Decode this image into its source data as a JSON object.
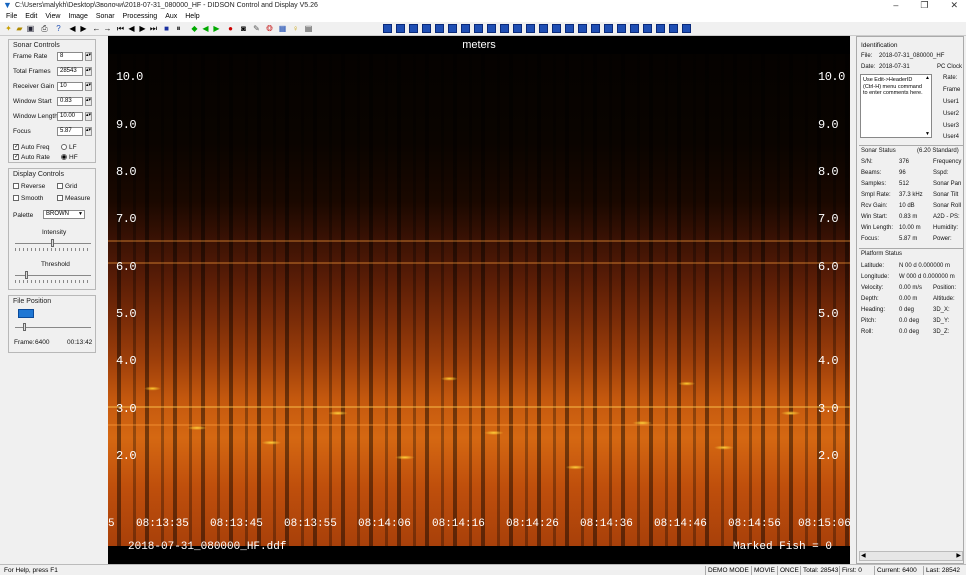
{
  "window": {
    "title": "C:\\Users\\malykh\\Desktop\\Зволочи\\2018-07-31_080000_HF - DIDSON Control and Display  V5.26",
    "minimize": "–",
    "maximize": "❐",
    "close": "✕"
  },
  "menu": [
    "File",
    "Edit",
    "View",
    "Image",
    "Sonar",
    "Processing",
    "Aux",
    "Help"
  ],
  "sonar_controls": {
    "title": "Sonar Controls",
    "frame_rate_label": "Frame Rate",
    "frame_rate": "8",
    "total_frames_label": "Total Frames",
    "total_frames": "28543",
    "receiver_gain_label": "Receiver Gain",
    "receiver_gain": "10",
    "window_start_label": "Window Start",
    "window_start": "0.83",
    "window_length_label": "Window Length",
    "window_length": "10.00",
    "focus_label": "Focus",
    "focus": "5.87",
    "auto_freq": "Auto Freq",
    "auto_rate": "Auto Rate",
    "lf": "LF",
    "hf": "HF"
  },
  "display_controls": {
    "title": "Display Controls",
    "reverse": "Reverse",
    "grid": "Grid",
    "smooth": "Smooth",
    "measure": "Measure",
    "palette_label": "Palette",
    "palette": "BROWN",
    "intensity_label": "Intensity",
    "threshold_label": "Threshold"
  },
  "file_position": {
    "title": "File Position",
    "frame_label": "Frame:",
    "frame": "6400",
    "time": "00:13:42"
  },
  "viewer": {
    "units": "meters",
    "y_labels": [
      "10.0",
      "9.0",
      "8.0",
      "7.0",
      "6.0",
      "5.0",
      "4.0",
      "3.0",
      "2.0"
    ],
    "time_labels": [
      "08:13:35",
      "08:13:45",
      "08:13:55",
      "08:14:06",
      "08:14:16",
      "08:14:26",
      "08:14:36",
      "08:14:46",
      "08:14:56",
      "08:15:06"
    ],
    "left_partial": "5",
    "filename": "2018-07-31_080000_HF.ddf",
    "marked_fish": "Marked Fish = 0"
  },
  "identification": {
    "title": "Identification",
    "file_label": "File:",
    "file": "2018-07-31_080000_HF",
    "date_label": "Date:",
    "date": "2018-07-31",
    "pc_clock": "PC Clock",
    "comment_lines": [
      "Use Edit->HeaderID",
      "(Ctrl-H) menu command",
      "to enter comments here."
    ],
    "side": [
      "Rate:",
      "Frame",
      "User1",
      "User2",
      "User3",
      "User4"
    ]
  },
  "sonar_status": {
    "title": "Sonar Status",
    "standard": "(6.20 Standard)",
    "rows": [
      [
        "S/N:",
        "376",
        "Frequency"
      ],
      [
        "Beams:",
        "96",
        "Sspd:"
      ],
      [
        "Samples:",
        "512",
        "Sonar Pan"
      ],
      [
        "Smpl Rate:",
        "37.3 kHz",
        "Sonar Tilt"
      ],
      [
        "Rcv Gain:",
        "10 dB",
        "Sonar Roll"
      ],
      [
        "Win Start:",
        "0.83 m",
        "A2D - PS:"
      ],
      [
        "Win Length:",
        "10.00 m",
        "Humidity:"
      ],
      [
        "Focus:",
        "5.87 m",
        "Power:"
      ]
    ]
  },
  "platform_status": {
    "title": "Platform Status",
    "rows": [
      [
        "Latitude:",
        "N  00 d  0.000000 m"
      ],
      [
        "Longitude:",
        "W 000 d  0.000000 m"
      ],
      [
        "Velocity:",
        "0.00 m/s",
        "Position:"
      ],
      [
        "Depth:",
        "0.00 m",
        "Altitude:"
      ],
      [
        "Heading:",
        "0 deg",
        "3D_X:"
      ],
      [
        "Pitch:",
        "0.0 deg",
        "3D_Y:"
      ],
      [
        "Roll:",
        "0.0 deg",
        "3D_Z:"
      ]
    ]
  },
  "statusbar": {
    "help": "For Help, press F1",
    "mode": "DEMO MODE",
    "movie": "MOVIE",
    "once": "ONCE",
    "total": "Total: 28543",
    "first": "First: 0",
    "current": "Current: 6400",
    "last": "Last: 28542"
  },
  "colors": {
    "accent": "#1f4fb4",
    "sonar_hot": "#ffd23c",
    "sonar_base": "#c4580e"
  }
}
